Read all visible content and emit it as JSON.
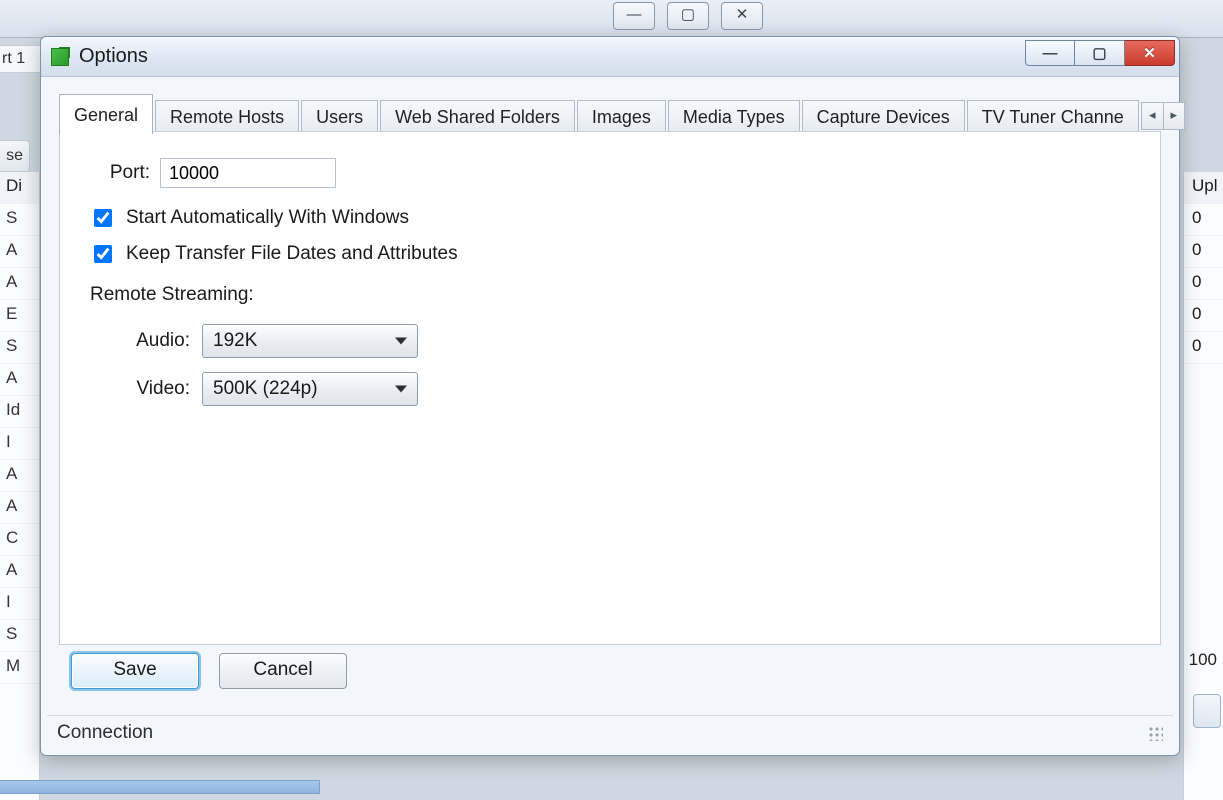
{
  "bg": {
    "port_tab": "rt 1",
    "se_tab": "se",
    "left_header": "Di",
    "left_rows": [
      "S",
      "A",
      "A",
      "E",
      "S",
      "A",
      "Id",
      "I",
      "A",
      "A",
      "C",
      "A",
      "I",
      "S",
      "M"
    ],
    "right_header": "Upl",
    "right_rows": [
      "0",
      "0",
      "0",
      "0",
      "0"
    ],
    "bottom_value": "100"
  },
  "dialog": {
    "title": "Options",
    "tabs": [
      "General",
      "Remote Hosts",
      "Users",
      "Web Shared Folders",
      "Images",
      "Media Types",
      "Capture Devices",
      "TV Tuner Channe"
    ],
    "active_tab_index": 0,
    "form": {
      "port_label": "Port:",
      "port_value": "10000",
      "autostart_checked": true,
      "autostart_label": "Start Automatically With Windows",
      "keep_dates_checked": true,
      "keep_dates_label": "Keep Transfer File Dates and Attributes",
      "remote_streaming_label": "Remote Streaming:",
      "audio_label": "Audio:",
      "audio_value": "192K",
      "video_label": "Video:",
      "video_value": "500K (224p)"
    },
    "buttons": {
      "save": "Save",
      "cancel": "Cancel"
    },
    "status": "Connection"
  }
}
